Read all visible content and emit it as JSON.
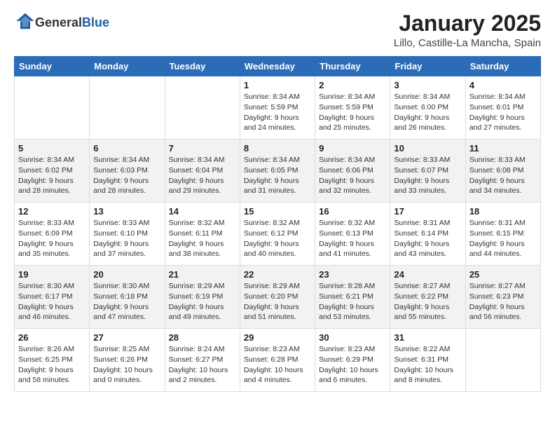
{
  "header": {
    "logo_general": "General",
    "logo_blue": "Blue",
    "title": "January 2025",
    "subtitle": "Lillo, Castille-La Mancha, Spain"
  },
  "weekdays": [
    "Sunday",
    "Monday",
    "Tuesday",
    "Wednesday",
    "Thursday",
    "Friday",
    "Saturday"
  ],
  "weeks": [
    [
      {
        "day": "",
        "info": ""
      },
      {
        "day": "",
        "info": ""
      },
      {
        "day": "",
        "info": ""
      },
      {
        "day": "1",
        "info": "Sunrise: 8:34 AM\nSunset: 5:59 PM\nDaylight: 9 hours\nand 24 minutes."
      },
      {
        "day": "2",
        "info": "Sunrise: 8:34 AM\nSunset: 5:59 PM\nDaylight: 9 hours\nand 25 minutes."
      },
      {
        "day": "3",
        "info": "Sunrise: 8:34 AM\nSunset: 6:00 PM\nDaylight: 9 hours\nand 26 minutes."
      },
      {
        "day": "4",
        "info": "Sunrise: 8:34 AM\nSunset: 6:01 PM\nDaylight: 9 hours\nand 27 minutes."
      }
    ],
    [
      {
        "day": "5",
        "info": "Sunrise: 8:34 AM\nSunset: 6:02 PM\nDaylight: 9 hours\nand 28 minutes."
      },
      {
        "day": "6",
        "info": "Sunrise: 8:34 AM\nSunset: 6:03 PM\nDaylight: 9 hours\nand 28 minutes."
      },
      {
        "day": "7",
        "info": "Sunrise: 8:34 AM\nSunset: 6:04 PM\nDaylight: 9 hours\nand 29 minutes."
      },
      {
        "day": "8",
        "info": "Sunrise: 8:34 AM\nSunset: 6:05 PM\nDaylight: 9 hours\nand 31 minutes."
      },
      {
        "day": "9",
        "info": "Sunrise: 8:34 AM\nSunset: 6:06 PM\nDaylight: 9 hours\nand 32 minutes."
      },
      {
        "day": "10",
        "info": "Sunrise: 8:33 AM\nSunset: 6:07 PM\nDaylight: 9 hours\nand 33 minutes."
      },
      {
        "day": "11",
        "info": "Sunrise: 8:33 AM\nSunset: 6:08 PM\nDaylight: 9 hours\nand 34 minutes."
      }
    ],
    [
      {
        "day": "12",
        "info": "Sunrise: 8:33 AM\nSunset: 6:09 PM\nDaylight: 9 hours\nand 35 minutes."
      },
      {
        "day": "13",
        "info": "Sunrise: 8:33 AM\nSunset: 6:10 PM\nDaylight: 9 hours\nand 37 minutes."
      },
      {
        "day": "14",
        "info": "Sunrise: 8:32 AM\nSunset: 6:11 PM\nDaylight: 9 hours\nand 38 minutes."
      },
      {
        "day": "15",
        "info": "Sunrise: 8:32 AM\nSunset: 6:12 PM\nDaylight: 9 hours\nand 40 minutes."
      },
      {
        "day": "16",
        "info": "Sunrise: 8:32 AM\nSunset: 6:13 PM\nDaylight: 9 hours\nand 41 minutes."
      },
      {
        "day": "17",
        "info": "Sunrise: 8:31 AM\nSunset: 6:14 PM\nDaylight: 9 hours\nand 43 minutes."
      },
      {
        "day": "18",
        "info": "Sunrise: 8:31 AM\nSunset: 6:15 PM\nDaylight: 9 hours\nand 44 minutes."
      }
    ],
    [
      {
        "day": "19",
        "info": "Sunrise: 8:30 AM\nSunset: 6:17 PM\nDaylight: 9 hours\nand 46 minutes."
      },
      {
        "day": "20",
        "info": "Sunrise: 8:30 AM\nSunset: 6:18 PM\nDaylight: 9 hours\nand 47 minutes."
      },
      {
        "day": "21",
        "info": "Sunrise: 8:29 AM\nSunset: 6:19 PM\nDaylight: 9 hours\nand 49 minutes."
      },
      {
        "day": "22",
        "info": "Sunrise: 8:29 AM\nSunset: 6:20 PM\nDaylight: 9 hours\nand 51 minutes."
      },
      {
        "day": "23",
        "info": "Sunrise: 8:28 AM\nSunset: 6:21 PM\nDaylight: 9 hours\nand 53 minutes."
      },
      {
        "day": "24",
        "info": "Sunrise: 8:27 AM\nSunset: 6:22 PM\nDaylight: 9 hours\nand 55 minutes."
      },
      {
        "day": "25",
        "info": "Sunrise: 8:27 AM\nSunset: 6:23 PM\nDaylight: 9 hours\nand 56 minutes."
      }
    ],
    [
      {
        "day": "26",
        "info": "Sunrise: 8:26 AM\nSunset: 6:25 PM\nDaylight: 9 hours\nand 58 minutes."
      },
      {
        "day": "27",
        "info": "Sunrise: 8:25 AM\nSunset: 6:26 PM\nDaylight: 10 hours\nand 0 minutes."
      },
      {
        "day": "28",
        "info": "Sunrise: 8:24 AM\nSunset: 6:27 PM\nDaylight: 10 hours\nand 2 minutes."
      },
      {
        "day": "29",
        "info": "Sunrise: 8:23 AM\nSunset: 6:28 PM\nDaylight: 10 hours\nand 4 minutes."
      },
      {
        "day": "30",
        "info": "Sunrise: 8:23 AM\nSunset: 6:29 PM\nDaylight: 10 hours\nand 6 minutes."
      },
      {
        "day": "31",
        "info": "Sunrise: 8:22 AM\nSunset: 6:31 PM\nDaylight: 10 hours\nand 8 minutes."
      },
      {
        "day": "",
        "info": ""
      }
    ]
  ],
  "row_shading": [
    false,
    true,
    false,
    true,
    false
  ]
}
